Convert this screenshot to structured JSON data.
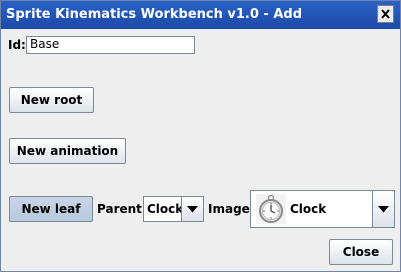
{
  "window": {
    "title": "Sprite Kinematics Workbench v1.0 - Add"
  },
  "form": {
    "id_label": "Id:",
    "id_value": "Base",
    "new_root_label": "New root",
    "new_animation_label": "New animation",
    "new_leaf_label": "New leaf",
    "parent_label": "Parent:",
    "parent_value": "Clock",
    "image_label": "Image:",
    "image_value": "Clock",
    "image_icon": "pocket-watch-icon"
  },
  "footer": {
    "close_label": "Close"
  }
}
